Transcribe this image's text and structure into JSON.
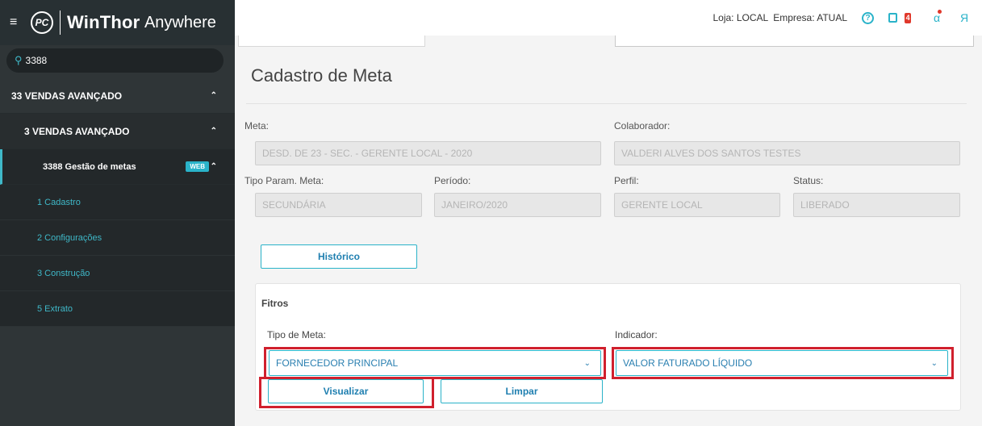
{
  "app": {
    "name_bold": "WinThor",
    "name_regular": "Anywhere",
    "logo_text": "PC"
  },
  "search": {
    "value": "3388"
  },
  "menu": {
    "l1": {
      "label": "33  VENDAS AVANÇADO"
    },
    "l2": {
      "label": "3  VENDAS AVANÇADO"
    },
    "l3": {
      "label": "3388  Gestão de metas",
      "badge": "WEB"
    },
    "items": [
      {
        "label": "1  Cadastro"
      },
      {
        "label": "2  Configurações"
      },
      {
        "label": "3  Construção"
      },
      {
        "label": "5  Extrato"
      }
    ]
  },
  "topbar": {
    "loja": "Loja: LOCAL",
    "empresa": "Empresa: ATUAL",
    "mail_count": "4"
  },
  "page": {
    "title": "Cadastro de Meta"
  },
  "form": {
    "meta_label": "Meta:",
    "meta_value": "DESD. DE 23 - SEC. - GERENTE LOCAL - 2020",
    "colaborador_label": "Colaborador:",
    "colaborador_value": "VALDERI ALVES DOS SANTOS TESTES",
    "tipo_param_label": "Tipo Param. Meta:",
    "tipo_param_value": "SECUNDÁRIA",
    "periodo_label": "Período:",
    "periodo_value": "JANEIRO/2020",
    "perfil_label": "Perfil:",
    "perfil_value": "GERENTE LOCAL",
    "status_label": "Status:",
    "status_value": "LIBERADO",
    "historico_button": "Histórico"
  },
  "filters": {
    "title": "Fitros",
    "tipo_meta_label": "Tipo de Meta:",
    "tipo_meta_value": "FORNECEDOR PRINCIPAL",
    "indicador_label": "Indicador:",
    "indicador_value": "VALOR FATURADO LÍQUIDO",
    "visualizar_button": "Visualizar",
    "limpar_button": "Limpar"
  },
  "colors": {
    "accent": "#2ab3c9",
    "highlight": "#d0202d",
    "sidebar": "#2f3537"
  }
}
